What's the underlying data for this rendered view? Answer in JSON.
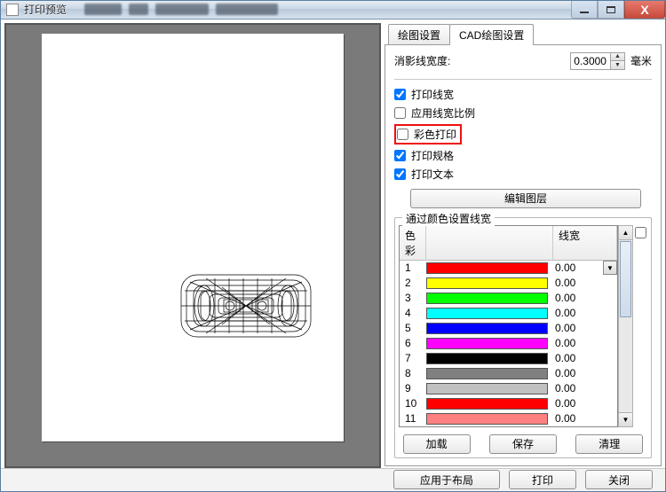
{
  "window": {
    "title": "打印预览"
  },
  "tabs": {
    "plot": "绘图设置",
    "cad": "CAD绘图设置"
  },
  "panel": {
    "hiddenLineWidthLabel": "消影线宽度:",
    "hiddenLineWidthValue": "0.3000",
    "unit": "毫米",
    "checks": {
      "printLineWidth": "打印线宽",
      "applyLineWidthScale": "应用线宽比例",
      "colorPrint": "彩色打印",
      "printSpec": "打印规格",
      "printText": "打印文本"
    },
    "checksState": {
      "printLineWidth": true,
      "applyLineWidthScale": false,
      "colorPrint": false,
      "printSpec": true,
      "printText": true
    },
    "editLayers": "编辑图层"
  },
  "colorGroup": {
    "legend": "通过颜色设置线宽",
    "headers": {
      "index": "色彩",
      "color": "",
      "lw": "线宽"
    },
    "rows": [
      {
        "i": "1",
        "color": "#ff0000",
        "lw": "0.00",
        "combo": true
      },
      {
        "i": "2",
        "color": "#ffff00",
        "lw": "0.00"
      },
      {
        "i": "3",
        "color": "#00ff00",
        "lw": "0.00"
      },
      {
        "i": "4",
        "color": "#00ffff",
        "lw": "0.00"
      },
      {
        "i": "5",
        "color": "#0000ff",
        "lw": "0.00"
      },
      {
        "i": "6",
        "color": "#ff00ff",
        "lw": "0.00"
      },
      {
        "i": "7",
        "color": "#000000",
        "lw": "0.00"
      },
      {
        "i": "8",
        "color": "#808080",
        "lw": "0.00"
      },
      {
        "i": "9",
        "color": "#c0c0c0",
        "lw": "0.00"
      },
      {
        "i": "10",
        "color": "#ff0000",
        "lw": "0.00"
      },
      {
        "i": "11",
        "color": "#ff8080",
        "lw": "0.00"
      }
    ],
    "buttons": {
      "load": "加载",
      "save": "保存",
      "clear": "清理"
    }
  },
  "footer": {
    "applyLayout": "应用于布局",
    "print": "打印",
    "close": "关闭"
  }
}
